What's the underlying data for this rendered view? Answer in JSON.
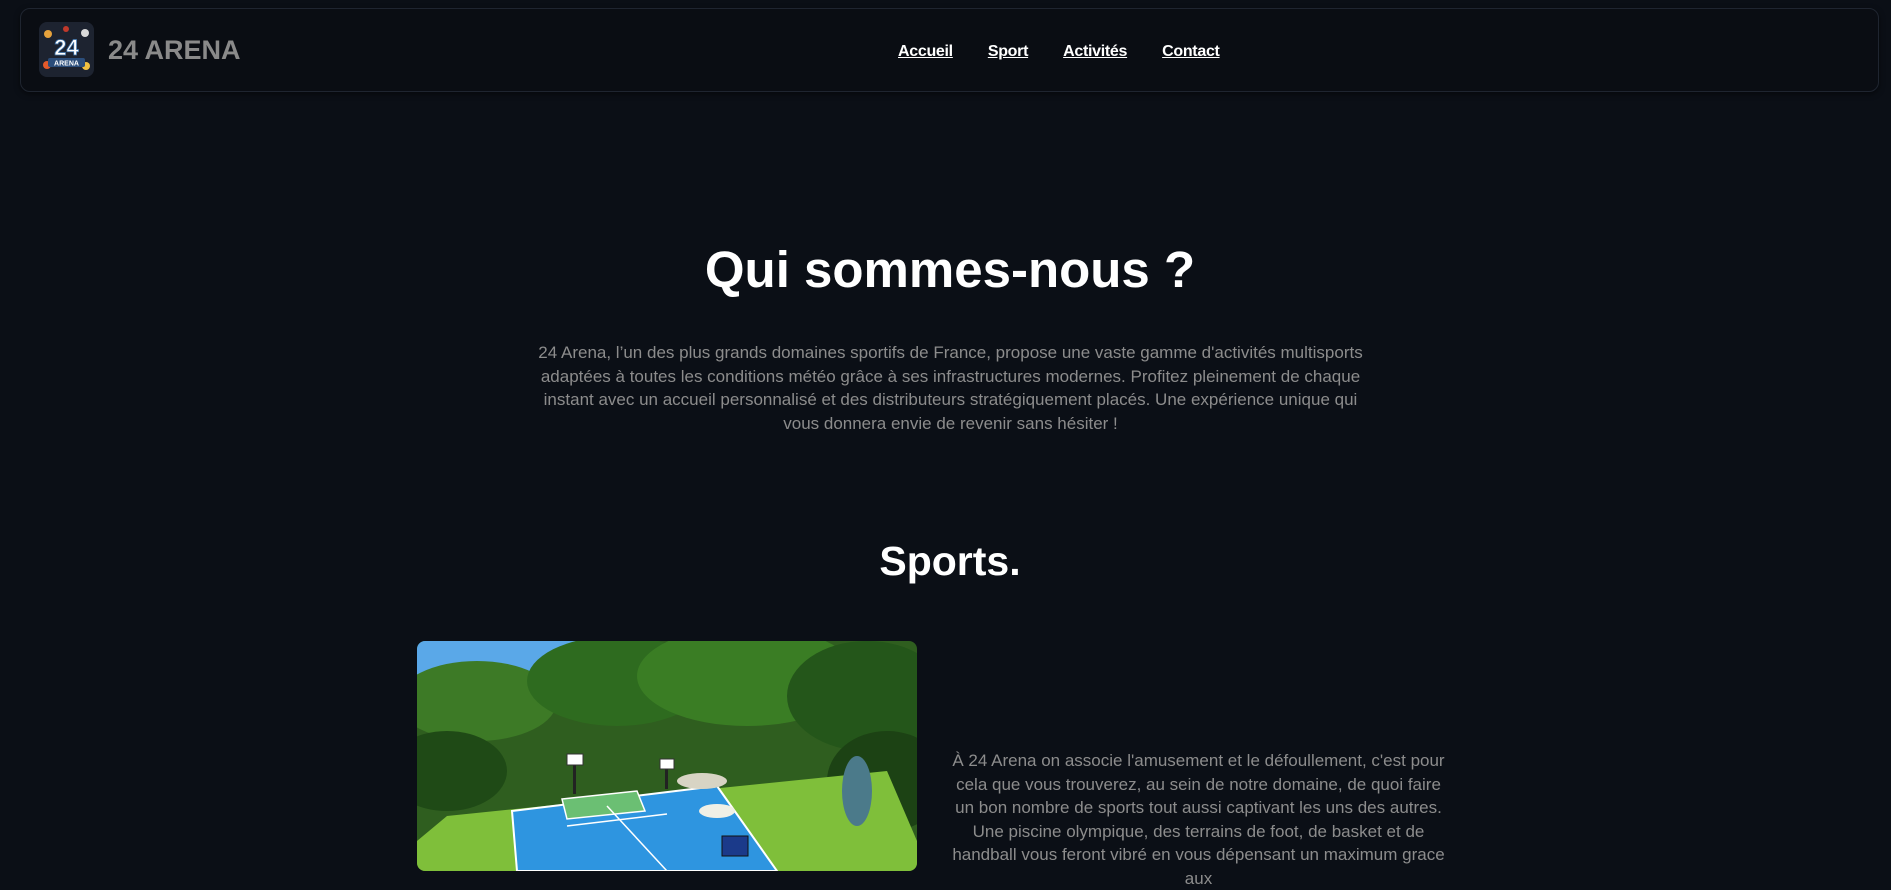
{
  "header": {
    "brand": "24 ARENA",
    "logo_text": "24",
    "logo_subtext": "ARENA"
  },
  "nav": {
    "items": [
      {
        "label": "Accueil"
      },
      {
        "label": "Sport"
      },
      {
        "label": "Activités"
      },
      {
        "label": "Contact"
      }
    ]
  },
  "about": {
    "title": "Qui sommes-nous ?",
    "text": "24 Arena, l’un des plus grands domaines sportifs de France, propose une vaste gamme d'activités multisports adaptées à toutes les conditions météo grâce à ses infrastructures modernes. Profitez pleinement de chaque instant avec un accueil personnalisé et des distributeurs stratégiquement placés. Une expérience unique qui vous donnera envie de revenir sans hésiter !"
  },
  "sports": {
    "title": "Sports.",
    "text": "À 24 Arena on associe l'amusement et le défoullement, c'est pour cela que vous trouverez, au sein de notre domaine, de quoi faire un bon nombre de sports tout aussi captivant les uns des autres. Une piscine olympique, des terrains de foot, de basket et de handball vous feront vibré en vous dépensant un maximum grace aux"
  },
  "colors": {
    "background": "#0b0f16",
    "navbar": "#0a0d13",
    "body_text": "#8c8c8c",
    "heading": "#ffffff"
  }
}
